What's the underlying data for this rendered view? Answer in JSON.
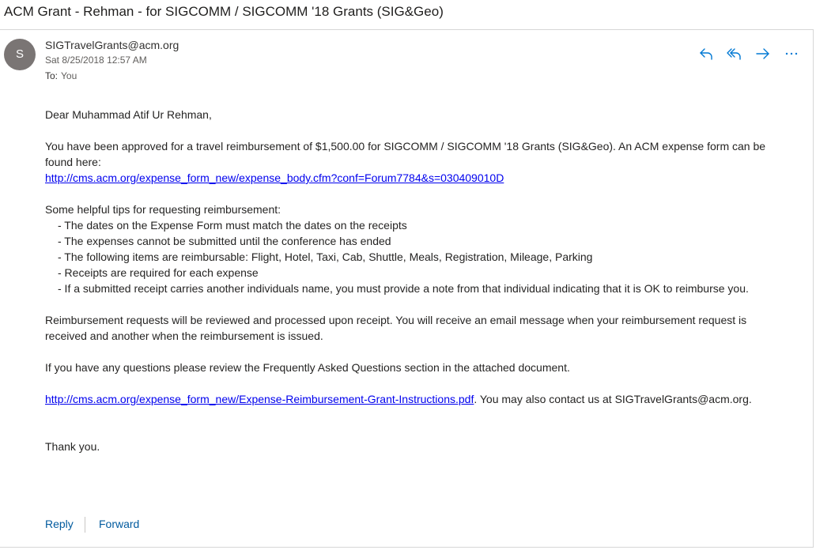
{
  "subject": "ACM Grant - Rehman - for SIGCOMM / SIGCOMM '18 Grants (SIG&Geo)",
  "header": {
    "avatar_initial": "S",
    "sender": "SIGTravelGrants@acm.org",
    "date": "Sat 8/25/2018 12:57 AM",
    "to_label": "To:",
    "to_value": "You"
  },
  "actions": {
    "icons": [
      "reply-icon",
      "reply-all-icon",
      "forward-icon",
      "more-icon"
    ],
    "more_label": "···"
  },
  "body": {
    "greeting": "Dear Muhammad Atif Ur Rehman,",
    "approval_line1": "You have been approved for a travel reimbursement of $1,500.00 for SIGCOMM / SIGCOMM '18 Grants (SIG&Geo). An ACM expense form can be",
    "approval_line2": "found here:",
    "expense_form_link": "http://cms.acm.org/expense_form_new/expense_body.cfm?conf=Forum7784&s=030409010D",
    "tips_heading": "Some helpful tips for requesting reimbursement:",
    "tips": [
      "- The dates on the Expense Form must match the dates on the receipts",
      "- The expenses cannot be submitted until the conference has ended",
      "- The following items are reimbursable: Flight, Hotel, Taxi, Cab, Shuttle, Meals, Registration, Mileage, Parking",
      "- Receipts are required for each expense",
      "- If a submitted receipt carries another individuals name, you must provide a note from that individual indicating that it is OK to reimburse you."
    ],
    "review_line1": "Reimbursement requests will be reviewed and processed upon receipt. You will receive an email message when your reimbursement request is",
    "review_line2": "received and another when the reimbursement is issued.",
    "questions": "If you have any questions please review the Frequently Asked Questions section in the attached document.",
    "instructions_link": "http://cms.acm.org/expense_form_new/Expense-Reimbursement-Grant-Instructions.pdf",
    "contact_text": ". You may also contact us at SIGTravelGrants@acm.org.",
    "thanks": "Thank you."
  },
  "footer": {
    "reply_label": "Reply",
    "forward_label": "Forward"
  },
  "colors": {
    "accent": "#0078d4",
    "link": "#0000ee",
    "footer_link": "#005a9e",
    "avatar_bg": "#7a7574"
  }
}
